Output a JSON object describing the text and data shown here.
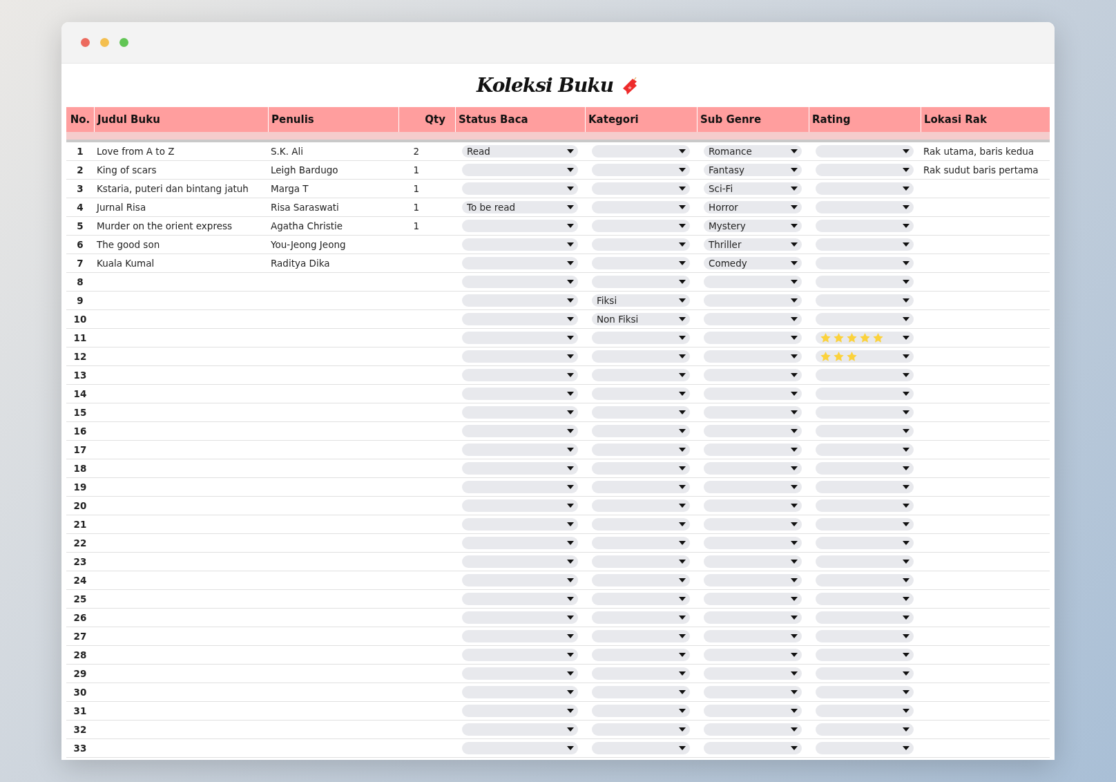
{
  "title": "Koleksi Buku",
  "columns": [
    "No.",
    "Judul Buku",
    "Penulis",
    "Qty",
    "Status Baca",
    "Kategori",
    "Sub Genre",
    "Rating",
    "Lokasi Rak"
  ],
  "rows": [
    {
      "no": "1",
      "title": "Love from A to Z",
      "author": "S.K. Ali",
      "qty": "2",
      "status": "Read",
      "subgenre": "Romance",
      "location": "Rak utama, baris kedua"
    },
    {
      "no": "2",
      "title": "King of scars",
      "author": "Leigh Bardugo",
      "qty": "1",
      "subgenre": "Fantasy",
      "location": "Rak sudut baris pertama"
    },
    {
      "no": "3",
      "title": "Kstaria, puteri dan bintang jatuh",
      "author": "Marga T",
      "qty": "1",
      "subgenre": "Sci-Fi"
    },
    {
      "no": "4",
      "title": "Jurnal Risa",
      "author": "Risa Saraswati",
      "qty": "1",
      "status": "To be read",
      "subgenre": "Horror"
    },
    {
      "no": "5",
      "title": "Murder on the orient express",
      "author": "Agatha Christie",
      "qty": "1",
      "subgenre": "Mystery"
    },
    {
      "no": "6",
      "title": "The good son",
      "author": "You-Jeong Jeong",
      "subgenre": "Thriller"
    },
    {
      "no": "7",
      "title": "Kuala Kumal",
      "author": "Raditya Dika",
      "subgenre": "Comedy"
    },
    {
      "no": "8"
    },
    {
      "no": "9",
      "category": "Fiksi"
    },
    {
      "no": "10",
      "category": "Non Fiksi"
    },
    {
      "no": "11",
      "stars": 5
    },
    {
      "no": "12",
      "stars": 3
    },
    {
      "no": "13"
    },
    {
      "no": "14"
    },
    {
      "no": "15"
    },
    {
      "no": "16"
    },
    {
      "no": "17"
    },
    {
      "no": "18"
    },
    {
      "no": "19"
    },
    {
      "no": "20"
    },
    {
      "no": "21"
    },
    {
      "no": "22"
    },
    {
      "no": "23"
    },
    {
      "no": "24"
    },
    {
      "no": "25"
    },
    {
      "no": "26"
    },
    {
      "no": "27"
    },
    {
      "no": "28"
    },
    {
      "no": "29"
    },
    {
      "no": "30"
    },
    {
      "no": "31"
    },
    {
      "no": "32"
    },
    {
      "no": "33"
    }
  ]
}
